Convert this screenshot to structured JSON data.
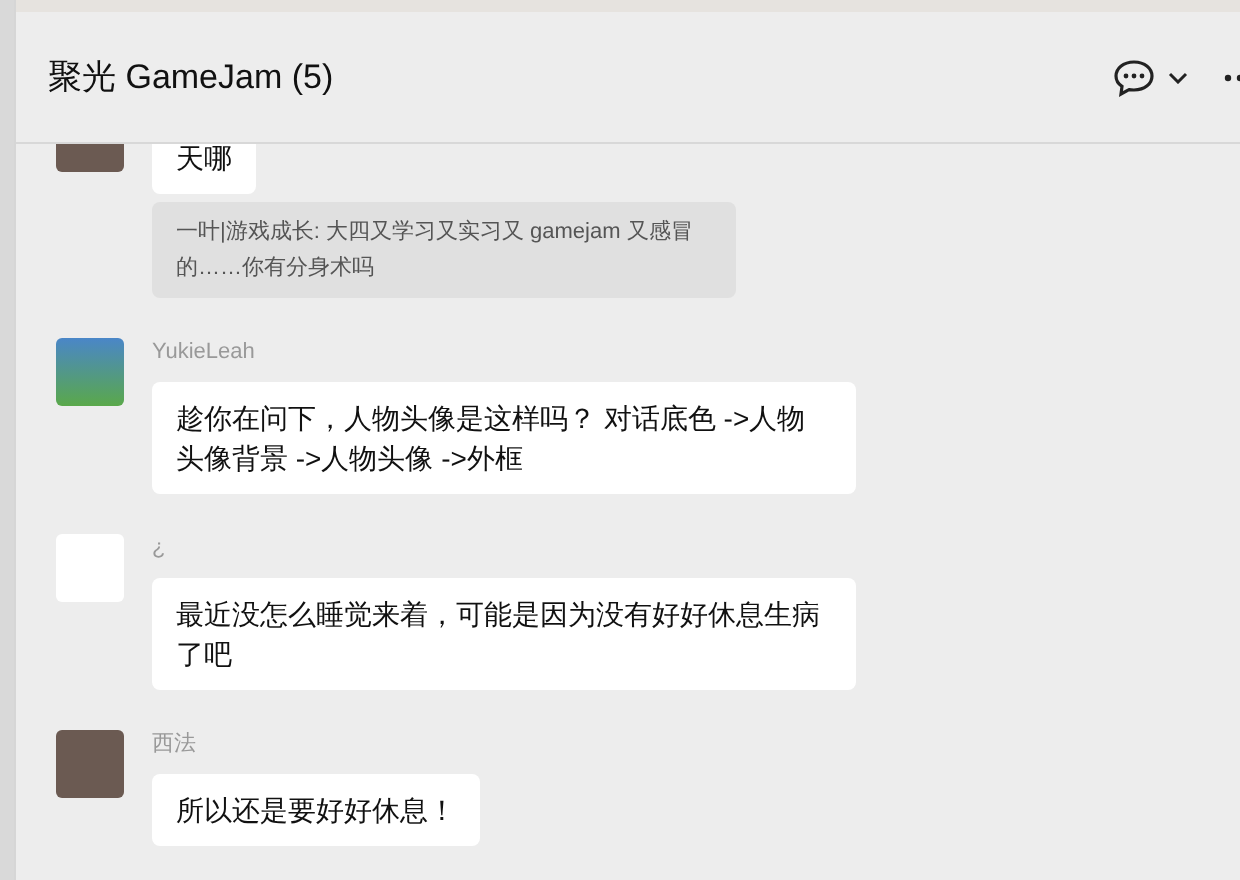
{
  "header": {
    "title": "聚光 GameJam (5)"
  },
  "messages": [
    {
      "kind": "photo",
      "text": "天哪",
      "quote": "一叶|游戏成长: 大四又学习又实习又 gamejam 又感冒的……你有分身术吗",
      "cut": true
    },
    {
      "kind": "flower",
      "sender": "YukieLeah",
      "text": "趁你在问下，人物头像是这样吗？ 对话底色 ->人物头像背景 ->人物头像 ->外框"
    },
    {
      "kind": "blank",
      "sender": "¿",
      "text": "最近没怎么睡觉来着，可能是因为没有好好休息生病了吧"
    },
    {
      "kind": "photo",
      "sender": "西法",
      "text": "所以还是要好好休息！"
    }
  ]
}
